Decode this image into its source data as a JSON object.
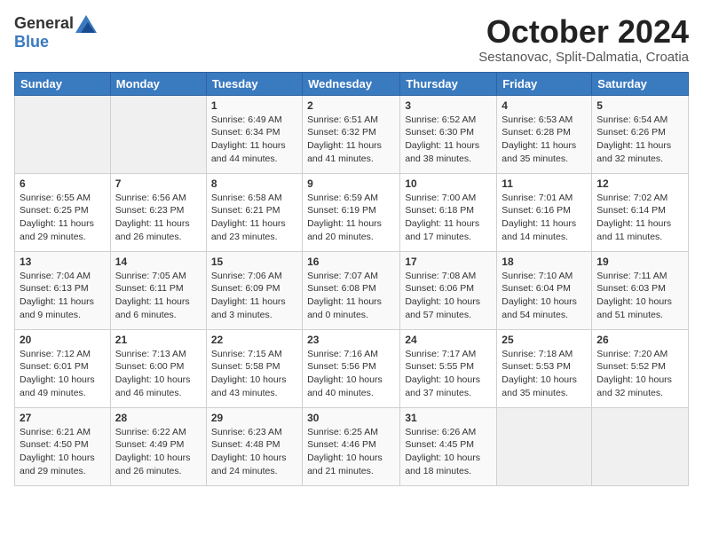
{
  "logo": {
    "general": "General",
    "blue": "Blue"
  },
  "title": "October 2024",
  "location": "Sestanovac, Split-Dalmatia, Croatia",
  "headers": [
    "Sunday",
    "Monday",
    "Tuesday",
    "Wednesday",
    "Thursday",
    "Friday",
    "Saturday"
  ],
  "weeks": [
    [
      {
        "day": "",
        "sunrise": "",
        "sunset": "",
        "daylight": ""
      },
      {
        "day": "",
        "sunrise": "",
        "sunset": "",
        "daylight": ""
      },
      {
        "day": "1",
        "sunrise": "Sunrise: 6:49 AM",
        "sunset": "Sunset: 6:34 PM",
        "daylight": "Daylight: 11 hours and 44 minutes."
      },
      {
        "day": "2",
        "sunrise": "Sunrise: 6:51 AM",
        "sunset": "Sunset: 6:32 PM",
        "daylight": "Daylight: 11 hours and 41 minutes."
      },
      {
        "day": "3",
        "sunrise": "Sunrise: 6:52 AM",
        "sunset": "Sunset: 6:30 PM",
        "daylight": "Daylight: 11 hours and 38 minutes."
      },
      {
        "day": "4",
        "sunrise": "Sunrise: 6:53 AM",
        "sunset": "Sunset: 6:28 PM",
        "daylight": "Daylight: 11 hours and 35 minutes."
      },
      {
        "day": "5",
        "sunrise": "Sunrise: 6:54 AM",
        "sunset": "Sunset: 6:26 PM",
        "daylight": "Daylight: 11 hours and 32 minutes."
      }
    ],
    [
      {
        "day": "6",
        "sunrise": "Sunrise: 6:55 AM",
        "sunset": "Sunset: 6:25 PM",
        "daylight": "Daylight: 11 hours and 29 minutes."
      },
      {
        "day": "7",
        "sunrise": "Sunrise: 6:56 AM",
        "sunset": "Sunset: 6:23 PM",
        "daylight": "Daylight: 11 hours and 26 minutes."
      },
      {
        "day": "8",
        "sunrise": "Sunrise: 6:58 AM",
        "sunset": "Sunset: 6:21 PM",
        "daylight": "Daylight: 11 hours and 23 minutes."
      },
      {
        "day": "9",
        "sunrise": "Sunrise: 6:59 AM",
        "sunset": "Sunset: 6:19 PM",
        "daylight": "Daylight: 11 hours and 20 minutes."
      },
      {
        "day": "10",
        "sunrise": "Sunrise: 7:00 AM",
        "sunset": "Sunset: 6:18 PM",
        "daylight": "Daylight: 11 hours and 17 minutes."
      },
      {
        "day": "11",
        "sunrise": "Sunrise: 7:01 AM",
        "sunset": "Sunset: 6:16 PM",
        "daylight": "Daylight: 11 hours and 14 minutes."
      },
      {
        "day": "12",
        "sunrise": "Sunrise: 7:02 AM",
        "sunset": "Sunset: 6:14 PM",
        "daylight": "Daylight: 11 hours and 11 minutes."
      }
    ],
    [
      {
        "day": "13",
        "sunrise": "Sunrise: 7:04 AM",
        "sunset": "Sunset: 6:13 PM",
        "daylight": "Daylight: 11 hours and 9 minutes."
      },
      {
        "day": "14",
        "sunrise": "Sunrise: 7:05 AM",
        "sunset": "Sunset: 6:11 PM",
        "daylight": "Daylight: 11 hours and 6 minutes."
      },
      {
        "day": "15",
        "sunrise": "Sunrise: 7:06 AM",
        "sunset": "Sunset: 6:09 PM",
        "daylight": "Daylight: 11 hours and 3 minutes."
      },
      {
        "day": "16",
        "sunrise": "Sunrise: 7:07 AM",
        "sunset": "Sunset: 6:08 PM",
        "daylight": "Daylight: 11 hours and 0 minutes."
      },
      {
        "day": "17",
        "sunrise": "Sunrise: 7:08 AM",
        "sunset": "Sunset: 6:06 PM",
        "daylight": "Daylight: 10 hours and 57 minutes."
      },
      {
        "day": "18",
        "sunrise": "Sunrise: 7:10 AM",
        "sunset": "Sunset: 6:04 PM",
        "daylight": "Daylight: 10 hours and 54 minutes."
      },
      {
        "day": "19",
        "sunrise": "Sunrise: 7:11 AM",
        "sunset": "Sunset: 6:03 PM",
        "daylight": "Daylight: 10 hours and 51 minutes."
      }
    ],
    [
      {
        "day": "20",
        "sunrise": "Sunrise: 7:12 AM",
        "sunset": "Sunset: 6:01 PM",
        "daylight": "Daylight: 10 hours and 49 minutes."
      },
      {
        "day": "21",
        "sunrise": "Sunrise: 7:13 AM",
        "sunset": "Sunset: 6:00 PM",
        "daylight": "Daylight: 10 hours and 46 minutes."
      },
      {
        "day": "22",
        "sunrise": "Sunrise: 7:15 AM",
        "sunset": "Sunset: 5:58 PM",
        "daylight": "Daylight: 10 hours and 43 minutes."
      },
      {
        "day": "23",
        "sunrise": "Sunrise: 7:16 AM",
        "sunset": "Sunset: 5:56 PM",
        "daylight": "Daylight: 10 hours and 40 minutes."
      },
      {
        "day": "24",
        "sunrise": "Sunrise: 7:17 AM",
        "sunset": "Sunset: 5:55 PM",
        "daylight": "Daylight: 10 hours and 37 minutes."
      },
      {
        "day": "25",
        "sunrise": "Sunrise: 7:18 AM",
        "sunset": "Sunset: 5:53 PM",
        "daylight": "Daylight: 10 hours and 35 minutes."
      },
      {
        "day": "26",
        "sunrise": "Sunrise: 7:20 AM",
        "sunset": "Sunset: 5:52 PM",
        "daylight": "Daylight: 10 hours and 32 minutes."
      }
    ],
    [
      {
        "day": "27",
        "sunrise": "Sunrise: 6:21 AM",
        "sunset": "Sunset: 4:50 PM",
        "daylight": "Daylight: 10 hours and 29 minutes."
      },
      {
        "day": "28",
        "sunrise": "Sunrise: 6:22 AM",
        "sunset": "Sunset: 4:49 PM",
        "daylight": "Daylight: 10 hours and 26 minutes."
      },
      {
        "day": "29",
        "sunrise": "Sunrise: 6:23 AM",
        "sunset": "Sunset: 4:48 PM",
        "daylight": "Daylight: 10 hours and 24 minutes."
      },
      {
        "day": "30",
        "sunrise": "Sunrise: 6:25 AM",
        "sunset": "Sunset: 4:46 PM",
        "daylight": "Daylight: 10 hours and 21 minutes."
      },
      {
        "day": "31",
        "sunrise": "Sunrise: 6:26 AM",
        "sunset": "Sunset: 4:45 PM",
        "daylight": "Daylight: 10 hours and 18 minutes."
      },
      {
        "day": "",
        "sunrise": "",
        "sunset": "",
        "daylight": ""
      },
      {
        "day": "",
        "sunrise": "",
        "sunset": "",
        "daylight": ""
      }
    ]
  ]
}
